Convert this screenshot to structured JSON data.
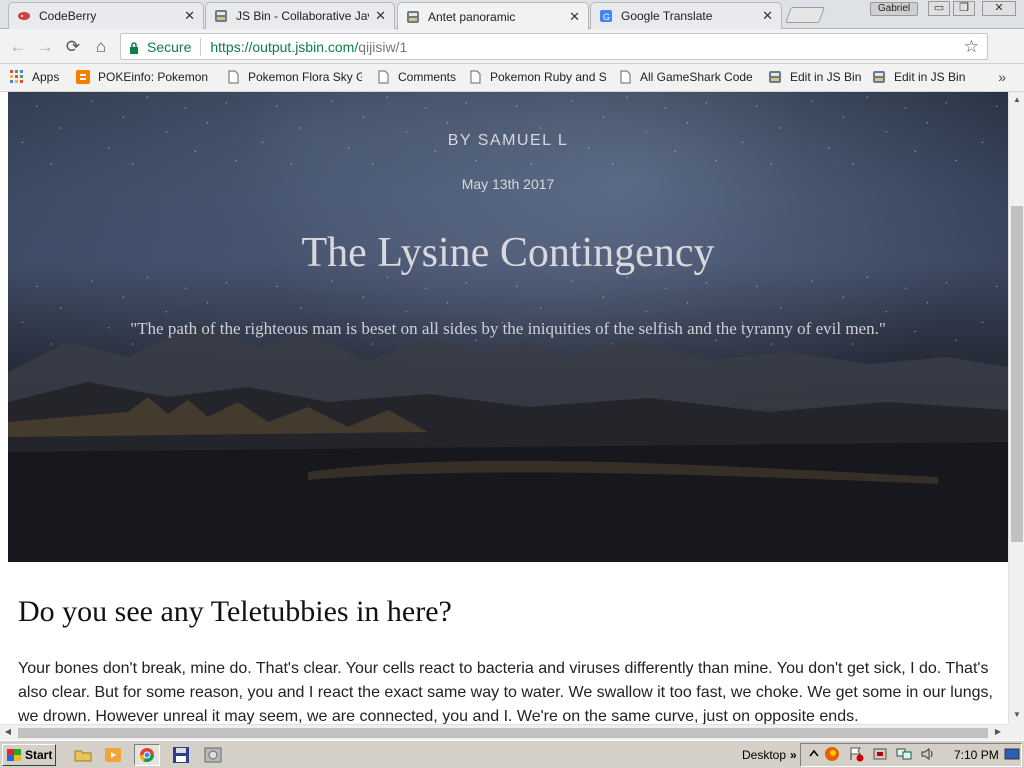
{
  "tabs": [
    {
      "title": "CodeBerry",
      "active": false
    },
    {
      "title": "JS Bin - Collaborative JavaS",
      "active": false
    },
    {
      "title": "Antet panoramic",
      "active": true
    },
    {
      "title": "Google Translate",
      "active": false
    }
  ],
  "window": {
    "user": "Gabriel",
    "min": "▭",
    "restore": "❐",
    "close": "✕"
  },
  "toolbar": {
    "back_icon": "←",
    "forward_icon": "→",
    "reload_icon": "⟳",
    "home_icon": "⌂",
    "secure_label": "Secure",
    "url_base": "https://output.jsbin.com/",
    "url_path": "qijisiw/1",
    "star_icon": "☆"
  },
  "bookmarks": {
    "items": [
      {
        "label": "Apps"
      },
      {
        "label": "POKEinfo: Pokemon Fl"
      },
      {
        "label": "Pokemon Flora Sky Gu"
      },
      {
        "label": "Comments"
      },
      {
        "label": "Pokemon Ruby and Sa"
      },
      {
        "label": "All GameShark Code I"
      },
      {
        "label": "Edit in JS Bin"
      },
      {
        "label": "Edit in JS Bin"
      }
    ],
    "more": "»"
  },
  "page": {
    "byline": "BY SAMUEL L",
    "date": "May 13th 2017",
    "title": "The Lysine Contingency",
    "quote": "\"The path of the righteous man is beset on all sides by the iniquities of the selfish and the tyranny of evil men.\"",
    "heading": "Do you see any Teletubbies in here?",
    "paragraph": "Your bones don't break, mine do. That's clear. Your cells react to bacteria and viruses differently than mine. You don't get sick, I do. That's also clear. But for some reason, you and I react the exact same way to water. We swallow it too fast, we choke. We get some in our lungs, we drown. However unreal it may seem, we are connected, you and I. We're on the same curve, just on opposite ends."
  },
  "taskbar": {
    "start_label": "Start",
    "desktop_label": "Desktop",
    "chevron": "»",
    "clock": "7:10 PM"
  },
  "colors": {
    "secure_green": "#0b8043",
    "taskbar_gray": "#d4d0c8"
  }
}
